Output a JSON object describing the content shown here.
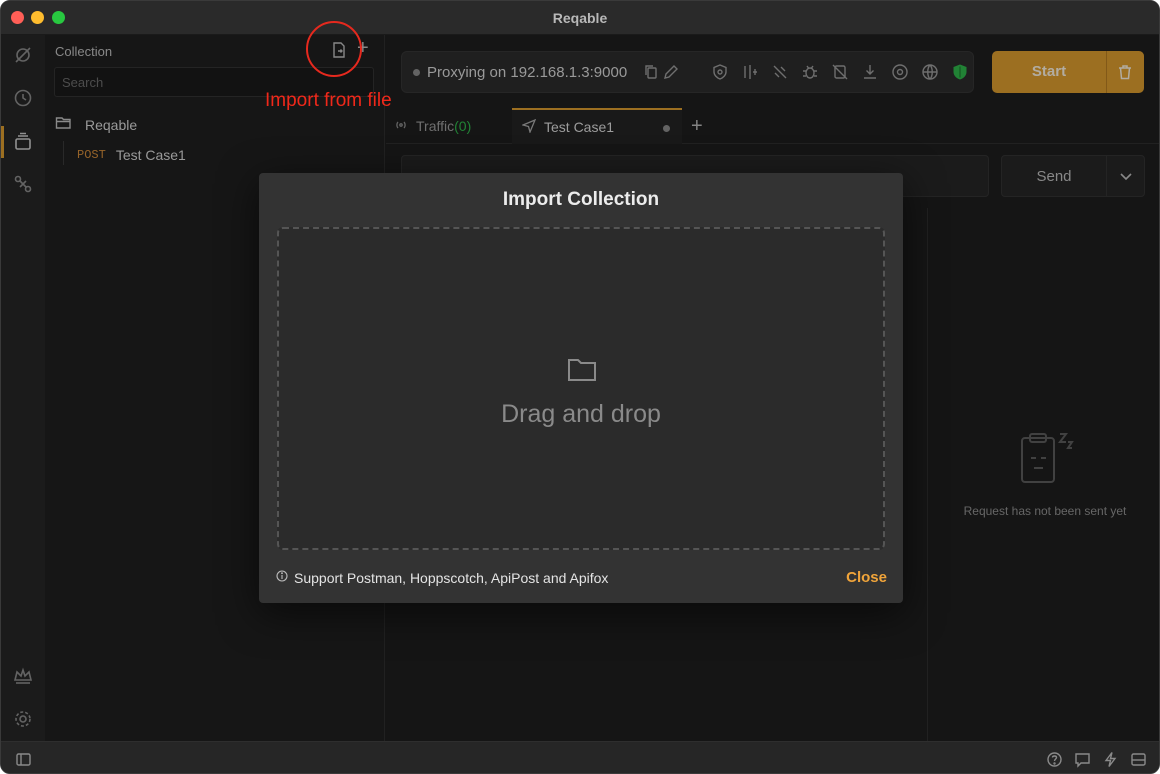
{
  "window": {
    "title": "Reqable"
  },
  "collection": {
    "title": "Collection",
    "search_placeholder": "Search",
    "folder_name": "Reqable",
    "items": [
      {
        "method": "POST",
        "name": "Test Case1"
      }
    ]
  },
  "annotation": {
    "text": "Import from file"
  },
  "proxy": {
    "status_text": "Proxying on 192.168.1.3:9000"
  },
  "start_button": {
    "label": "Start"
  },
  "tabs": {
    "traffic_label": "Traffic",
    "traffic_count": "(0)",
    "active_label": "Test Case1"
  },
  "request": {
    "send_label": "Send"
  },
  "response": {
    "empty_text": "Request has not been sent yet"
  },
  "modal": {
    "title": "Import Collection",
    "drop_text": "Drag and drop",
    "info_text": "Support Postman, Hoppscotch, ApiPost and Apifox",
    "close_label": "Close"
  },
  "colors": {
    "accent": "#d89a2f",
    "annotation": "#e6291e",
    "success": "#2fb54a",
    "close_text": "#f0a43a"
  }
}
